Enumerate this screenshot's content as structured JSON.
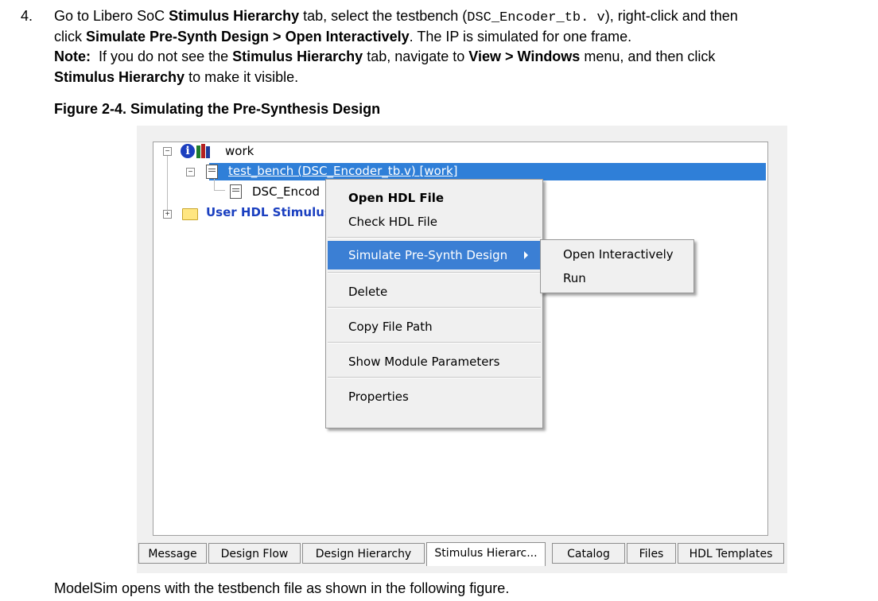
{
  "step": {
    "number": "4.",
    "line1": {
      "t1": "Go to Libero SoC ",
      "b1": "Stimulus Hierarchy",
      "t2": " tab, select the testbench (",
      "code": "DSC_Encoder_tb. v",
      "t3": "), right-click and then"
    },
    "line2": {
      "t1": "click ",
      "b1": "Simulate Pre-Synth Design > Open Interactively",
      "t2": ". The IP is simulated for one frame."
    },
    "line3": {
      "b1": "Note:",
      "t1": "  If you do not see the ",
      "b2": "Stimulus Hierarchy",
      "t2": " tab, navigate to ",
      "b3": "View > Windows",
      "t3": " menu, and then click"
    },
    "line4": {
      "b1": "Stimulus Hierarchy",
      "t1": " to make it visible."
    }
  },
  "figure": {
    "title": "Figure 2-4. Simulating the Pre-Synthesis Design"
  },
  "tree": {
    "work": "work",
    "test_bench": "test_bench (DSC_Encoder_tb.v) [work]",
    "child": "DSC_Encod",
    "user_hdl": "User HDL Stimulus"
  },
  "context_menu": {
    "items": [
      "Open HDL File",
      "Check HDL File",
      "Simulate Pre-Synth Design",
      "Delete",
      "Copy File Path",
      "Show Module Parameters",
      "Properties"
    ]
  },
  "submenu": {
    "items": [
      "Open Interactively",
      "Run"
    ]
  },
  "tabs": [
    "Message",
    "Design Flow",
    "Design Hierarchy",
    "Stimulus Hierarc...",
    "Catalog",
    "Files",
    "HDL Templates"
  ],
  "footer_text": "ModelSim opens with the testbench file as shown in the following figure.",
  "colors": {
    "selection": "#2f7fd8",
    "menu_highlight": "#3b7fd4",
    "folder_link": "#1a3fc0"
  }
}
